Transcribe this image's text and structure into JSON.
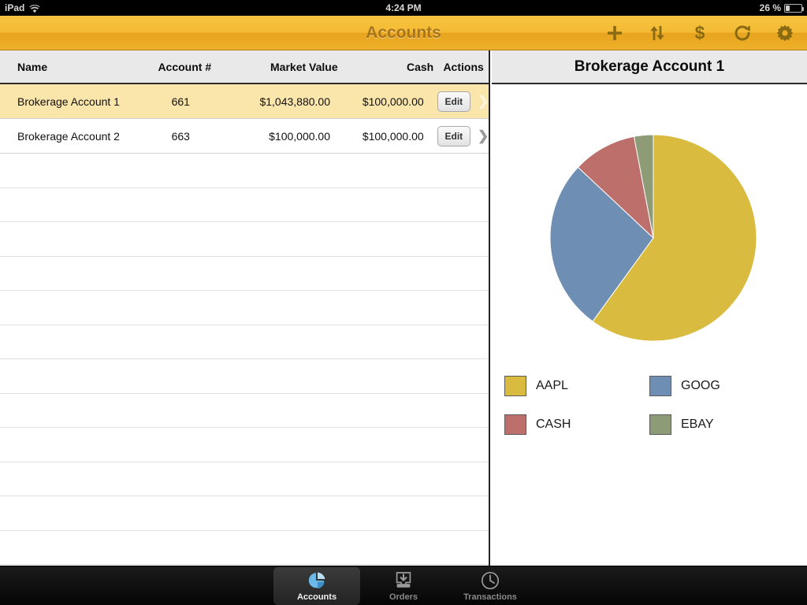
{
  "status_bar": {
    "device": "iPad",
    "wifi_icon": "wifi-icon",
    "time": "4:24 PM",
    "battery_percent": "26 %",
    "battery_icon": "battery-low-icon"
  },
  "navbar": {
    "title": "Accounts",
    "accent_color": "#f4bb35",
    "actions": [
      {
        "name": "add-button",
        "icon": "plus-icon"
      },
      {
        "name": "transfer-button",
        "icon": "transfer-arrows-icon"
      },
      {
        "name": "funds-button",
        "icon": "dollar-icon"
      },
      {
        "name": "refresh-button",
        "icon": "refresh-icon"
      },
      {
        "name": "settings-button",
        "icon": "gear-icon"
      }
    ]
  },
  "accounts_table": {
    "columns": [
      "Name",
      "Account #",
      "Market Value",
      "Cash",
      "Actions"
    ],
    "rows": [
      {
        "name": "Brokerage Account 1",
        "account_number": "661",
        "market_value": "$1,043,880.00",
        "cash": "$100,000.00",
        "edit_label": "Edit",
        "selected": true
      },
      {
        "name": "Brokerage Account 2",
        "account_number": "663",
        "market_value": "$100,000.00",
        "cash": "$100,000.00",
        "edit_label": "Edit",
        "selected": false
      }
    ],
    "empty_row_count": 12,
    "selected_row_color": "#fae5ab"
  },
  "detail_panel": {
    "title": "Brokerage Account 1"
  },
  "chart_data": {
    "type": "pie",
    "title": "Brokerage Account 1",
    "labels": [
      "AAPL",
      "GOOG",
      "CASH",
      "EBAY"
    ],
    "values": [
      60.0,
      27.0,
      10.0,
      3.0
    ],
    "colors": [
      "#d9bb3f",
      "#6e8fb3",
      "#bc6f6b",
      "#8d9c77"
    ],
    "legend_position": "bottom",
    "start_angle_deg": 0,
    "direction": "clockwise"
  },
  "tabbar": {
    "tabs": [
      {
        "label": "Accounts",
        "icon": "pie-chart-icon",
        "active": true
      },
      {
        "label": "Orders",
        "icon": "inbox-download-icon",
        "active": false
      },
      {
        "label": "Transactions",
        "icon": "clock-icon",
        "active": false
      }
    ]
  }
}
